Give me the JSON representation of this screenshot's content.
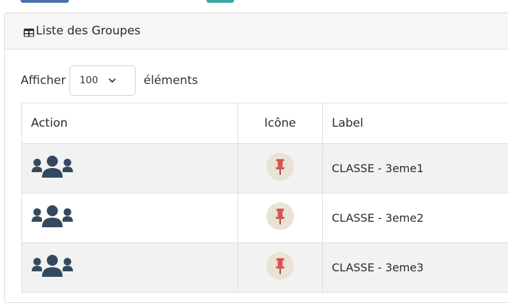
{
  "panel": {
    "title": "Liste des Groupes",
    "title_icon": "table-icon"
  },
  "length_menu": {
    "prefix": "Afficher",
    "selected": "100",
    "suffix": "éléments"
  },
  "table": {
    "columns": [
      "Action",
      "Icône",
      "Label"
    ],
    "rows": [
      {
        "action_icon": "users-icon",
        "icone": "pushpin-icon",
        "label": "CLASSE - 3eme1"
      },
      {
        "action_icon": "users-icon",
        "icone": "pushpin-icon",
        "label": "CLASSE - 3eme2"
      },
      {
        "action_icon": "users-icon",
        "icone": "pushpin-icon",
        "label": "CLASSE - 3eme3"
      }
    ]
  },
  "colors": {
    "icon_dark": "#34495e",
    "pin_red": "#d9534f",
    "pin_badge_bg": "#e8e3d4",
    "row_stripe": "#f2f2f2",
    "panel_header_bg": "#f6f6f6"
  }
}
